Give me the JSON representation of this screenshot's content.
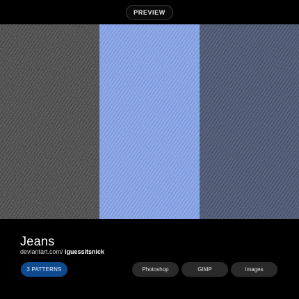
{
  "header": {
    "preview_label": "PREVIEW"
  },
  "swatches": [
    {
      "name": "black-denim",
      "base": "#303030",
      "light": "#4a4a4a",
      "dark": "#1e1e1e"
    },
    {
      "name": "light-blue-denim",
      "base": "#7e9ee6",
      "light": "#a9c2f4",
      "dark": "#5c7fd0"
    },
    {
      "name": "dark-blue-denim",
      "base": "#46506a",
      "light": "#626c86",
      "dark": "#2e364c"
    }
  ],
  "info": {
    "title": "Jeans",
    "credit_prefix": "deviantart.com/ ",
    "credit_author": "iguessitsnick",
    "patterns_label": "3 PATTERNS",
    "tags": [
      "Photoshop",
      "GIMP",
      "Images"
    ]
  },
  "colors": {
    "accent": "#0f4a8f",
    "background": "#000000",
    "tag_bg": "#2a2a2a"
  }
}
